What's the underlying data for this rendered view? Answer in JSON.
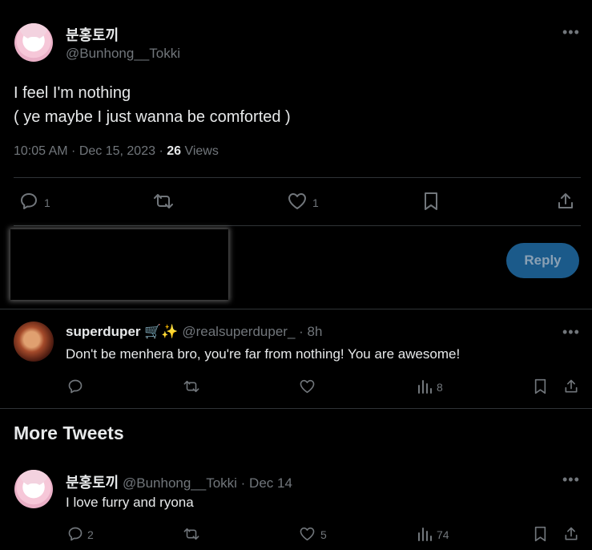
{
  "main_tweet": {
    "display_name": "분홍토끼",
    "handle": "@Bunhong__Tokki",
    "text_line1": "I feel I'm nothing",
    "text_line2": "( ye maybe I just wanna be comforted )",
    "time": "10:05 AM · Dec 15, 2023 · ",
    "views_count": "26",
    "views_label": " Views",
    "reply_count": "1",
    "like_count": "1"
  },
  "composer": {
    "reply_button": "Reply"
  },
  "reply_tweet": {
    "display_name": "superduper",
    "emoji": "🛒✨",
    "handle": "@realsuperduper_",
    "time": " · 8h",
    "text": "Don't be menhera bro, you're far from nothing!  You are awesome!",
    "views_count": "8"
  },
  "more_tweets": {
    "heading": "More Tweets",
    "items": [
      {
        "display_name": "분홍토끼",
        "handle": "@Bunhong__Tokki",
        "time": " · Dec 14",
        "text": "I love furry and ryona",
        "reply_count": "2",
        "like_count": "5",
        "views_count": "74"
      }
    ]
  },
  "icons": {
    "more": "more-horizontal-icon",
    "reply": "reply-bubble-icon",
    "retweet": "retweet-icon",
    "like": "heart-icon",
    "bookmark": "bookmark-icon",
    "share": "share-icon",
    "views": "views-bars-icon"
  }
}
